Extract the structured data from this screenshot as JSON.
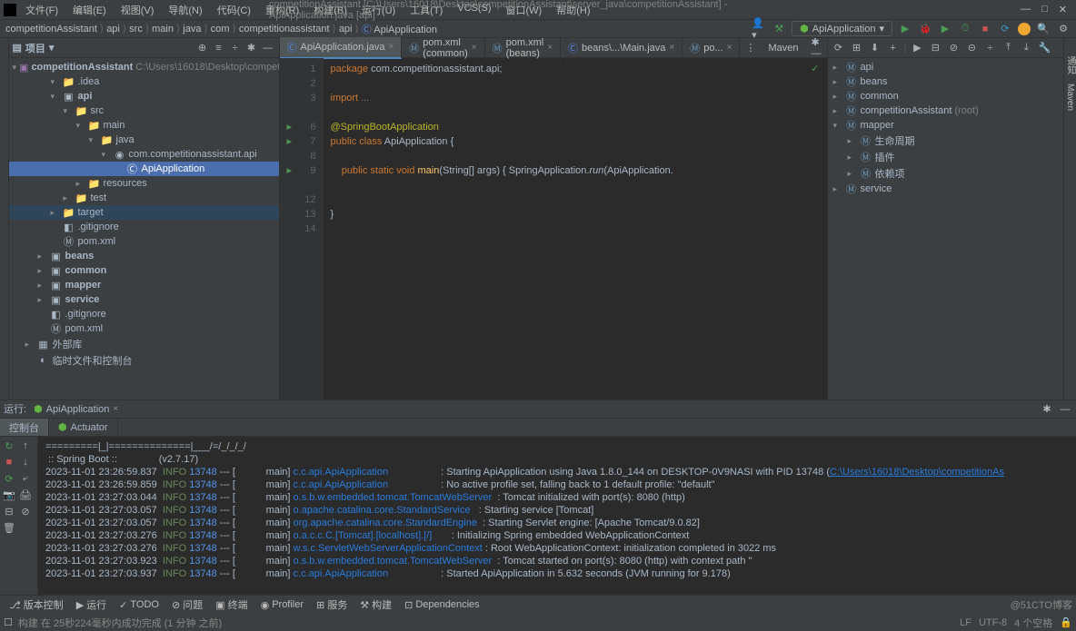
{
  "title": "competitionAssistant [C:\\Users\\16018\\Desktop\\competitionAssistant\\server_java\\competitionAssistant] - ApiApplication.java [api]",
  "menu": [
    "文件(F)",
    "编辑(E)",
    "视图(V)",
    "导航(N)",
    "代码(C)",
    "重构(R)",
    "构建(B)",
    "运行(U)",
    "工具(T)",
    "VCS(S)",
    "窗口(W)",
    "帮助(H)"
  ],
  "breadcrumb": [
    "competitionAssistant",
    "api",
    "src",
    "main",
    "java",
    "com",
    "competitionassistant",
    "api",
    "ApiApplication"
  ],
  "run_config": "ApiApplication",
  "project": {
    "title": "项目",
    "root": "competitionAssistant",
    "root_path": "C:\\Users\\16018\\Desktop\\competitionAssist",
    "items": [
      {
        "indent": 1,
        "arrow": "▾",
        "icon": "folder",
        "label": ".idea"
      },
      {
        "indent": 1,
        "arrow": "▾",
        "icon": "module",
        "label": "api",
        "bold": true
      },
      {
        "indent": 2,
        "arrow": "▾",
        "icon": "folder",
        "label": "src"
      },
      {
        "indent": 3,
        "arrow": "▾",
        "icon": "folder",
        "label": "main"
      },
      {
        "indent": 4,
        "arrow": "▾",
        "icon": "folder",
        "label": "java"
      },
      {
        "indent": 5,
        "arrow": "▾",
        "icon": "package",
        "label": "com.competitionassistant.api"
      },
      {
        "indent": 6,
        "arrow": "",
        "icon": "class",
        "label": "ApiApplication",
        "selected": true
      },
      {
        "indent": 3,
        "arrow": "▸",
        "icon": "folder",
        "label": "resources"
      },
      {
        "indent": 2,
        "arrow": "▸",
        "icon": "folder",
        "label": "test"
      },
      {
        "indent": 1,
        "arrow": "▸",
        "icon": "folder",
        "label": "target",
        "highlight": true
      },
      {
        "indent": 1,
        "arrow": "",
        "icon": "file",
        "label": ".gitignore"
      },
      {
        "indent": 1,
        "arrow": "",
        "icon": "xml",
        "label": "pom.xml"
      },
      {
        "indent": 0,
        "arrow": "▸",
        "icon": "module",
        "label": "beans",
        "bold": true
      },
      {
        "indent": 0,
        "arrow": "▸",
        "icon": "module",
        "label": "common",
        "bold": true
      },
      {
        "indent": 0,
        "arrow": "▸",
        "icon": "module",
        "label": "mapper",
        "bold": true
      },
      {
        "indent": 0,
        "arrow": "▸",
        "icon": "module",
        "label": "service",
        "bold": true
      },
      {
        "indent": 0,
        "arrow": "",
        "icon": "file",
        "label": ".gitignore"
      },
      {
        "indent": 0,
        "arrow": "",
        "icon": "xml",
        "label": "pom.xml"
      },
      {
        "indent": -1,
        "arrow": "▸",
        "icon": "lib",
        "label": "外部库"
      },
      {
        "indent": -1,
        "arrow": "",
        "icon": "scratch",
        "label": "临时文件和控制台"
      }
    ]
  },
  "tabs": [
    {
      "icon": "class",
      "label": "ApiApplication.java",
      "active": true
    },
    {
      "icon": "xml",
      "label": "pom.xml (common)"
    },
    {
      "icon": "xml",
      "label": "pom.xml (beans)"
    },
    {
      "icon": "class",
      "label": "beans\\...\\Main.java"
    },
    {
      "icon": "xml",
      "label": "po..."
    }
  ],
  "maven_title": "Maven",
  "code": {
    "lines": [
      {
        "n": 1,
        "html": "<span class='kw'>package</span> com.competitionassistant.api;"
      },
      {
        "n": 2,
        "html": ""
      },
      {
        "n": 3,
        "html": "<span class='kw'>import</span> <span class='com'>...</span>"
      },
      {
        "n": ""
      },
      {
        "n": 6,
        "html": "<span class='ann'>@SpringBootApplication</span>",
        "run": true
      },
      {
        "n": 7,
        "html": "<span class='kw'>public class</span> ApiApplication {",
        "run": true
      },
      {
        "n": 8,
        "html": ""
      },
      {
        "n": 9,
        "html": "    <span class='kw'>public static void</span> <span style='color:#ffc66d'>main</span>(String[] args) { SpringApplication.<span style='font-style:italic'>run</span>(ApiApplication.",
        "run": true
      },
      {
        "n": ""
      },
      {
        "n": 12,
        "html": ""
      },
      {
        "n": 13,
        "html": "}"
      },
      {
        "n": 14,
        "html": ""
      }
    ]
  },
  "maven_tree": [
    {
      "indent": 0,
      "arrow": "▸",
      "label": "api"
    },
    {
      "indent": 0,
      "arrow": "▸",
      "label": "beans"
    },
    {
      "indent": 0,
      "arrow": "▸",
      "label": "common"
    },
    {
      "indent": 0,
      "arrow": "▸",
      "label": "competitionAssistant",
      "suffix": "(root)"
    },
    {
      "indent": 0,
      "arrow": "▾",
      "label": "mapper"
    },
    {
      "indent": 1,
      "arrow": "▸",
      "label": "生命周期"
    },
    {
      "indent": 1,
      "arrow": "▸",
      "label": "插件"
    },
    {
      "indent": 1,
      "arrow": "▸",
      "label": "依赖项"
    },
    {
      "indent": 0,
      "arrow": "▸",
      "label": "service"
    }
  ],
  "run": {
    "title": "运行:",
    "tab": "ApiApplication",
    "sub_tabs": [
      "控制台",
      "Actuator"
    ],
    "banner1": "=========|_|==============|___/=/_/_/_/",
    "banner2": " :: Spring Boot ::               (v2.7.17)",
    "logs": [
      {
        "ts": "2023-11-01 23:26:59.837",
        "lvl": "INFO",
        "pid": "13748",
        "th": "main",
        "cls": "c.c.api.ApiApplication",
        "msg": ": Starting ApiApplication using Java 1.8.0_144 on DESKTOP-0V9NASI with PID 13748 (",
        "link": "C:\\Users\\16018\\Desktop\\competitionAs"
      },
      {
        "ts": "2023-11-01 23:26:59.859",
        "lvl": "INFO",
        "pid": "13748",
        "th": "main",
        "cls": "c.c.api.ApiApplication",
        "msg": ": No active profile set, falling back to 1 default profile: \"default\""
      },
      {
        "ts": "2023-11-01 23:27:03.044",
        "lvl": "INFO",
        "pid": "13748",
        "th": "main",
        "cls": "o.s.b.w.embedded.tomcat.TomcatWebServer",
        "msg": ": Tomcat initialized with port(s): 8080 (http)"
      },
      {
        "ts": "2023-11-01 23:27:03.057",
        "lvl": "INFO",
        "pid": "13748",
        "th": "main",
        "cls": "o.apache.catalina.core.StandardService",
        "msg": ": Starting service [Tomcat]"
      },
      {
        "ts": "2023-11-01 23:27:03.057",
        "lvl": "INFO",
        "pid": "13748",
        "th": "main",
        "cls": "org.apache.catalina.core.StandardEngine",
        "msg": ": Starting Servlet engine: [Apache Tomcat/9.0.82]"
      },
      {
        "ts": "2023-11-01 23:27:03.276",
        "lvl": "INFO",
        "pid": "13748",
        "th": "main",
        "cls": "o.a.c.c.C.[Tomcat].[localhost].[/]",
        "msg": ": Initializing Spring embedded WebApplicationContext"
      },
      {
        "ts": "2023-11-01 23:27:03.276",
        "lvl": "INFO",
        "pid": "13748",
        "th": "main",
        "cls": "w.s.c.ServletWebServerApplicationContext",
        "msg": ": Root WebApplicationContext: initialization completed in 3022 ms"
      },
      {
        "ts": "2023-11-01 23:27:03.923",
        "lvl": "INFO",
        "pid": "13748",
        "th": "main",
        "cls": "o.s.b.w.embedded.tomcat.TomcatWebServer",
        "msg": ": Tomcat started on port(s): 8080 (http) with context path ''"
      },
      {
        "ts": "2023-11-01 23:27:03.937",
        "lvl": "INFO",
        "pid": "13748",
        "th": "main",
        "cls": "c.c.api.ApiApplication",
        "msg": ": Started ApiApplication in 5.632 seconds (JVM running for 9.178)"
      }
    ]
  },
  "status": {
    "items": [
      "版本控制",
      "运行",
      "TODO",
      "问题",
      "终端",
      "Profiler",
      "服务",
      "构建",
      "Dependencies"
    ],
    "build": "构建 在 25秒224毫秒内成功完成 (1 分钟 之前)",
    "right": [
      "LF",
      "UTF-8",
      "4 个空格"
    ]
  }
}
